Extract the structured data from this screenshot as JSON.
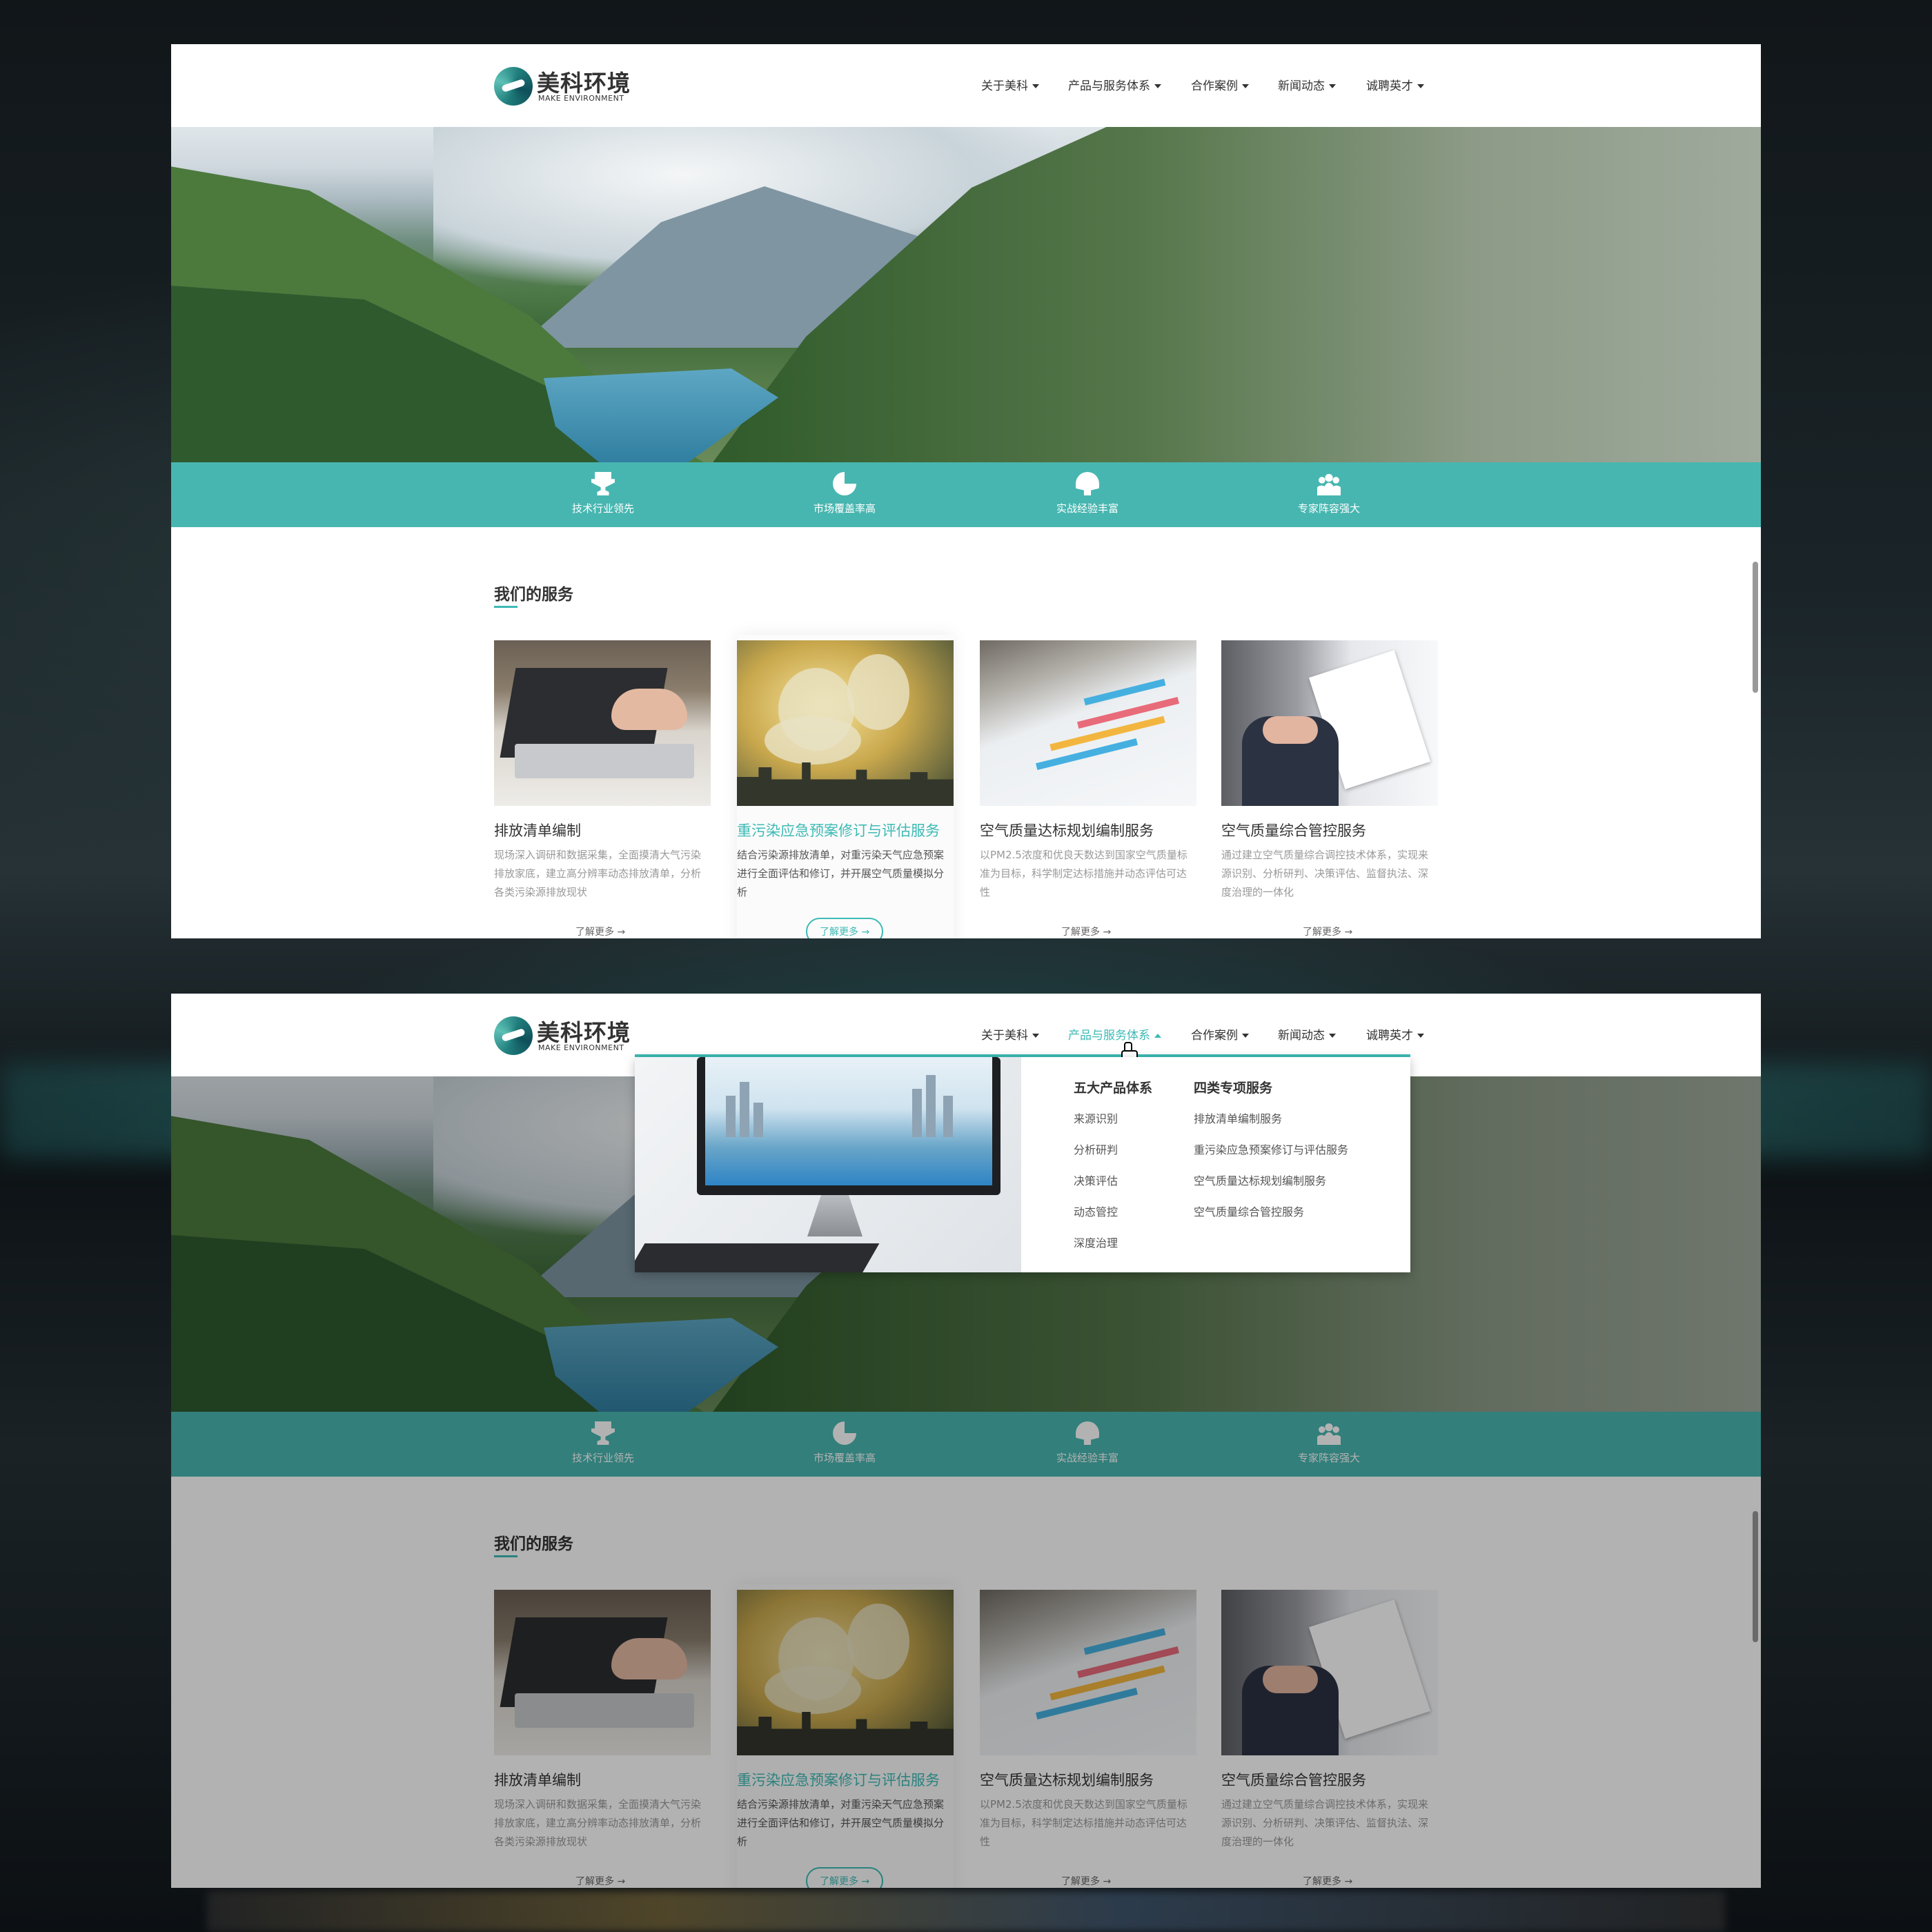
{
  "brand": {
    "name_cn": "美科环境",
    "name_en": "MAKE ENVIRONMENT",
    "accent": "#3dbab5",
    "feature_band": "#48b6b0"
  },
  "nav": {
    "items": [
      {
        "label": "关于美科"
      },
      {
        "label": "产品与服务体系"
      },
      {
        "label": "合作案例"
      },
      {
        "label": "新闻动态"
      },
      {
        "label": "诚聘英才"
      }
    ],
    "active_in_second_view": "产品与服务体系"
  },
  "features": [
    {
      "label": "技术行业领先",
      "icon": "trophy-icon"
    },
    {
      "label": "市场覆盖率高",
      "icon": "pie-chart-icon"
    },
    {
      "label": "实战经验丰富",
      "icon": "lightbulb-icon"
    },
    {
      "label": "专家阵容强大",
      "icon": "team-icon"
    }
  ],
  "services": {
    "title": "我们的服务",
    "cards": [
      {
        "title": "排放清单编制",
        "desc": "现场深入调研和数据采集，全面摸清大气污染排放家底，建立高分辨率动态排放清单，分析各类污染源排放现状",
        "more": "了解更多 →",
        "image": "laptop-photo"
      },
      {
        "title": "重污染应急预案修订与评估服务",
        "desc": "结合污染源排放清单，对重污染天气应急预案进行全面评估和修订，并开展空气质量模拟分析",
        "more": "了解更多 →",
        "image": "factory-smoke-photo"
      },
      {
        "title": "空气质量达标规划编制服务",
        "desc": "以PM2.5浓度和优良天数达到国家空气质量标准为目标，科学制定达标措施并动态评估可达性",
        "more": "了解更多 →",
        "image": "bar-chart-report-photo"
      },
      {
        "title": "空气质量综合管控服务",
        "desc": "通过建立空气质量综合调控技术体系，实现来源识别、分析研判、决策评估、监督执法、深度治理的一体化",
        "more": "了解更多 →",
        "image": "business-documents-photo"
      }
    ]
  },
  "dropdown": {
    "col1": {
      "title": "五大产品体系",
      "links": [
        "来源识别",
        "分析研判",
        "决策评估",
        "动态管控",
        "深度治理"
      ]
    },
    "col2": {
      "title": "四类专项服务",
      "links": [
        "排放清单编制服务",
        "重污染应急预案修订与评估服务",
        "空气质量达标规划编制服务",
        "空气质量综合管控服务"
      ]
    },
    "image": "desktop-monitor-photo"
  }
}
